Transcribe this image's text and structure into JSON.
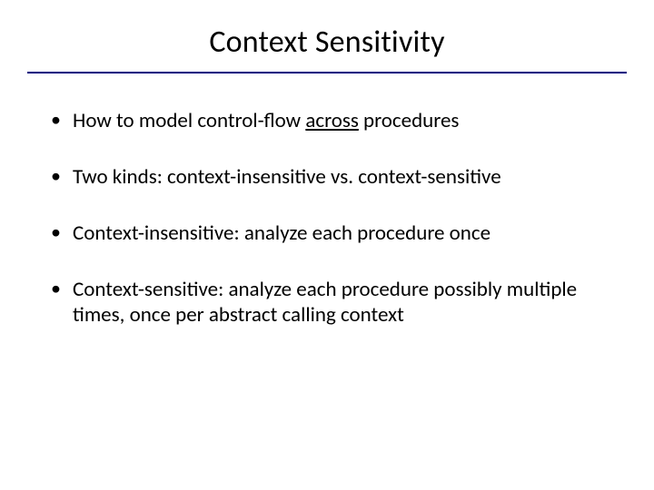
{
  "title": "Context Sensitivity",
  "bullets": [
    {
      "pre": "How to model control-flow ",
      "u": "across",
      "post": " procedures"
    },
    {
      "pre": "Two kinds: context-insensitive vs. context-sensitive",
      "u": "",
      "post": ""
    },
    {
      "pre": "Context-insensitive: analyze each procedure once",
      "u": "",
      "post": ""
    },
    {
      "pre": "Context-sensitive: analyze each procedure possibly multiple times, once per abstract calling context",
      "u": "",
      "post": ""
    }
  ]
}
